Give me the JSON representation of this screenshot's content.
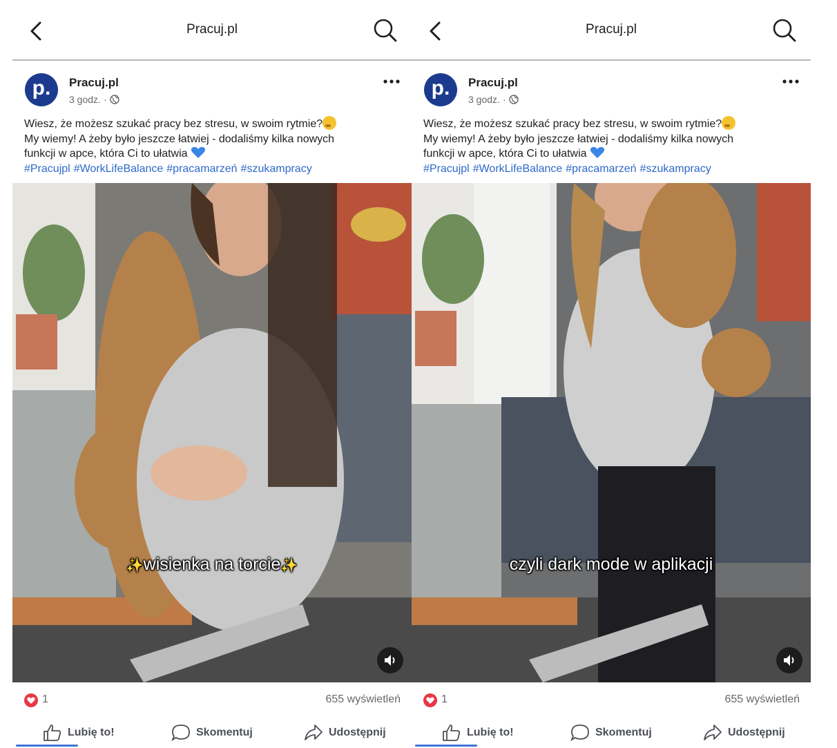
{
  "panels": [
    {
      "header": {
        "title": "Pracuj.pl"
      },
      "post": {
        "avatar_letter": "p.",
        "page_name": "Pracuj.pl",
        "time": "3 godz.",
        "separator": "·",
        "text_lines": [
          "Wiesz, że możesz szukać pracy bez stresu, w swoim rytmie?",
          "My wiemy! A żeby było jeszcze łatwiej - dodaliśmy kilka nowych",
          "funkcji w apce, która Ci to ułatwia"
        ],
        "hashtags": [
          "#Pracujpl",
          "#WorkLifeBalance",
          "#pracamarzeń",
          "#szukampracy"
        ],
        "video_caption": "wisienka na torcie",
        "caption_sparkles": true,
        "reaction_count": "1",
        "views": "655 wyświetleń"
      },
      "actions": {
        "like": "Lubię to!",
        "comment": "Skomentuj",
        "share": "Udostępnij"
      }
    },
    {
      "header": {
        "title": "Pracuj.pl"
      },
      "post": {
        "avatar_letter": "p.",
        "page_name": "Pracuj.pl",
        "time": "3 godz.",
        "separator": "·",
        "text_lines": [
          "Wiesz, że możesz szukać pracy bez stresu, w swoim rytmie?",
          "My wiemy! A żeby było jeszcze łatwiej - dodaliśmy kilka nowych",
          "funkcji w apce, która Ci to ułatwia"
        ],
        "hashtags": [
          "#Pracujpl",
          "#WorkLifeBalance",
          "#pracamarzeń",
          "#szukampracy"
        ],
        "video_caption": "czyli dark mode w aplikacji",
        "caption_sparkles": false,
        "reaction_count": "1",
        "views": "655 wyświetleń"
      },
      "actions": {
        "like": "Lubię to!",
        "comment": "Skomentuj",
        "share": "Udostępnij"
      }
    }
  ],
  "icons": {
    "back": "chevron-left-icon",
    "search": "search-icon",
    "more": "more-dots-icon",
    "audience": "globe-icon",
    "reaction": "heart-icon",
    "volume": "volume-icon",
    "like": "thumbs-up-icon",
    "comment": "comment-bubble-icon",
    "share": "share-arrow-icon"
  },
  "colors": {
    "accent": "#3f75d6",
    "hashtag": "#2d69c9",
    "avatar": "#1c3b8e",
    "heart": "#e63946",
    "divider": "#b8b8b8"
  }
}
